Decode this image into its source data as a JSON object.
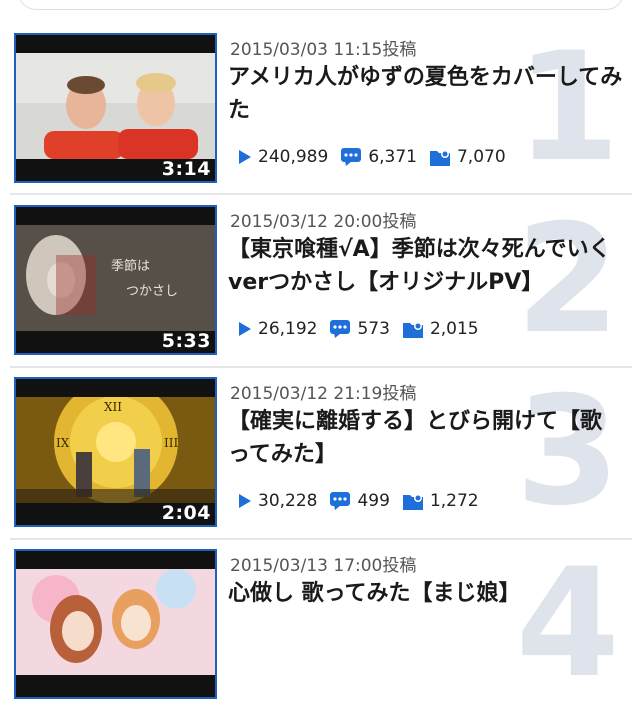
{
  "colors": {
    "accent": "#1e6fd9",
    "thumbnail_border": "#1f5fc0",
    "rank_number": "#dfe4ec",
    "divider": "#e4e6ea"
  },
  "videos": [
    {
      "rank": "1",
      "date": "2015/03/03 11:15投稿",
      "title": "アメリカ人がゆずの夏色をカバーしてみた",
      "duration": "3:14",
      "views": "240,989",
      "comments": "6,371",
      "mylists": "7,070"
    },
    {
      "rank": "2",
      "date": "2015/03/12 20:00投稿",
      "title": "【東京喰種√A】季節は次々死んでいくverつかさし【オリジナルPV】",
      "duration": "5:33",
      "views": "26,192",
      "comments": "573",
      "mylists": "2,015"
    },
    {
      "rank": "3",
      "date": "2015/03/12 21:19投稿",
      "title": "【確実に離婚する】とびら開けて【歌ってみた】",
      "duration": "2:04",
      "views": "30,228",
      "comments": "499",
      "mylists": "1,272"
    },
    {
      "rank": "4",
      "date": "2015/03/13 17:00投稿",
      "title": "心做し 歌ってみた【まじ娘】",
      "duration": "",
      "views": "",
      "comments": "",
      "mylists": ""
    }
  ]
}
